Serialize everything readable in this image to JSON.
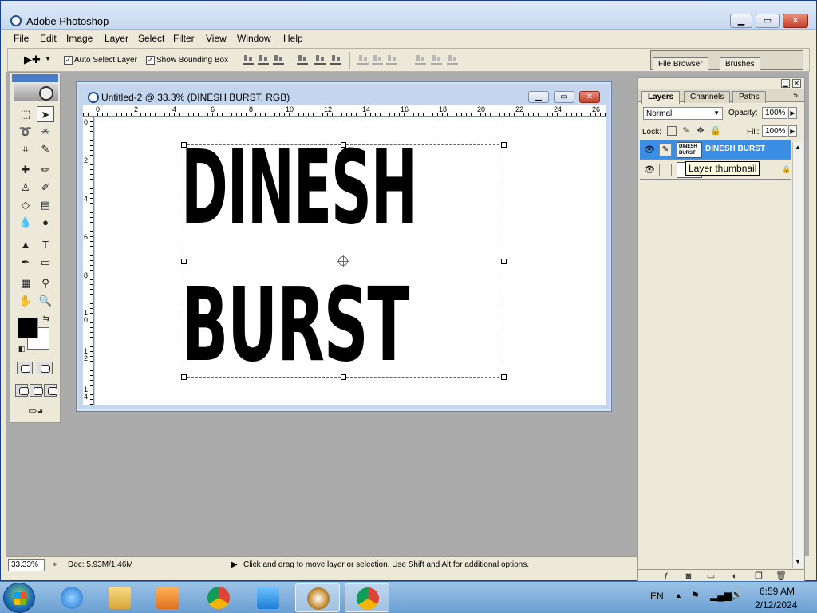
{
  "window": {
    "title": "Adobe Photoshop",
    "min": "▁",
    "max": "▭",
    "close": "✕"
  },
  "menu": [
    "File",
    "Edit",
    "Image",
    "Layer",
    "Select",
    "Filter",
    "View",
    "Window",
    "Help"
  ],
  "options": {
    "tool_glyph": "▶✚",
    "auto_select_label": "Auto Select Layer",
    "auto_select_checked": "✓",
    "show_bbox_label": "Show Bounding Box",
    "show_bbox_checked": "✓"
  },
  "well_tabs": [
    "File Browser",
    "Brushes"
  ],
  "document": {
    "title": "Untitled-2 @ 33.3% (DINESH BURST, RGB)",
    "ruler_h": [
      "0",
      "2",
      "4",
      "6",
      "8",
      "10",
      "12",
      "14",
      "16",
      "18",
      "20",
      "22",
      "24",
      "26"
    ],
    "ruler_v": [
      "0",
      "2",
      "4",
      "6",
      "8",
      "1 0",
      "1 2",
      "1 4"
    ],
    "line1": "DINESH",
    "line2": "BURST"
  },
  "layers_palette": {
    "tabs": [
      "Layers",
      "Channels",
      "Paths"
    ],
    "blend_mode": "Normal",
    "opacity_label": "Opacity:",
    "opacity_value": "100%",
    "lock_label": "Lock:",
    "fill_label": "Fill:",
    "fill_value": "100%",
    "layer1_name": "DINESH BURST",
    "layer1_thumb": "DINESH BURST",
    "tooltip": "Layer thumbnail"
  },
  "status": {
    "zoom": "33.33%",
    "doc": "Doc: 5.93M/1.46M",
    "hint": "Click and drag to move layer or selection.  Use Shift and Alt for additional options."
  },
  "tray": {
    "lang": "EN",
    "time": "6:59 AM",
    "date": "2/12/2024"
  },
  "colors": {
    "foreground": "#000000",
    "background": "#ffffff",
    "selection": "#3a8ee6"
  }
}
